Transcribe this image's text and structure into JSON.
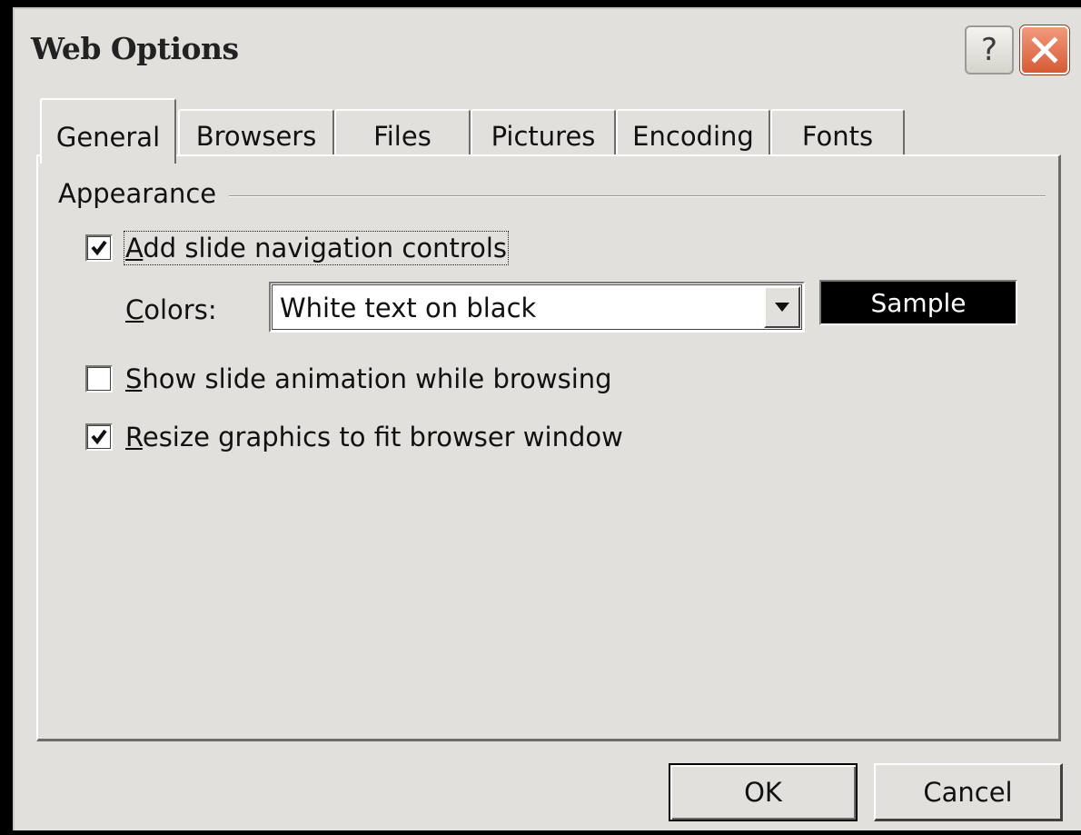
{
  "window": {
    "title": "Web Options",
    "help_button": "?",
    "close_button": "close"
  },
  "tabs": [
    {
      "label": "General",
      "active": true
    },
    {
      "label": "Browsers",
      "active": false
    },
    {
      "label": "Files",
      "active": false
    },
    {
      "label": "Pictures",
      "active": false
    },
    {
      "label": "Encoding",
      "active": false
    },
    {
      "label": "Fonts",
      "active": false
    }
  ],
  "appearance": {
    "group_label": "Appearance",
    "add_nav_controls": {
      "label_first": "A",
      "label_rest": "dd slide navigation controls",
      "checked": true
    },
    "colors": {
      "label_first": "C",
      "label_rest": "olors:",
      "selected": "White text on black"
    },
    "sample": {
      "label": "Sample",
      "background": "#000000",
      "text_color": "#ffffff"
    },
    "show_animation": {
      "label_first": "S",
      "label_rest": "how slide animation while browsing",
      "checked": false
    },
    "resize_graphics": {
      "label_first": "R",
      "label_rest": "esize graphics to fit browser window",
      "checked": true
    }
  },
  "buttons": {
    "ok": "OK",
    "cancel": "Cancel"
  },
  "colors": {
    "dialog_bg": "#e2e0dc",
    "close_red": "#d75a36",
    "screen_bg": "#000000"
  }
}
